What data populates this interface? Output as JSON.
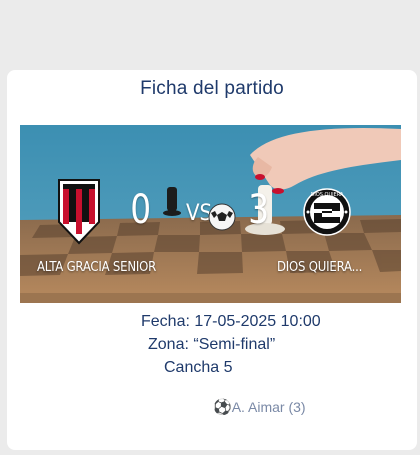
{
  "match": {
    "title": "Ficha del partido",
    "home_team": "ALTA GRACIA SENIOR",
    "away_team": "DIOS QUIERA...",
    "home_score": "0",
    "away_score": "3",
    "vs_label": "VS",
    "date_label": "Fecha: 17-05-2025 10:00",
    "zone_label": "Zona: “Semi-final”",
    "field_label": "Cancha 5",
    "scorer": "A. Aimar (3)"
  },
  "colors": {
    "title": "#1f3a6b",
    "scorer": "#7a89a6",
    "background": "#ebebeb",
    "card": "#ffffff"
  },
  "icons": {
    "scorer_icon": "soccer-ball-icon"
  }
}
